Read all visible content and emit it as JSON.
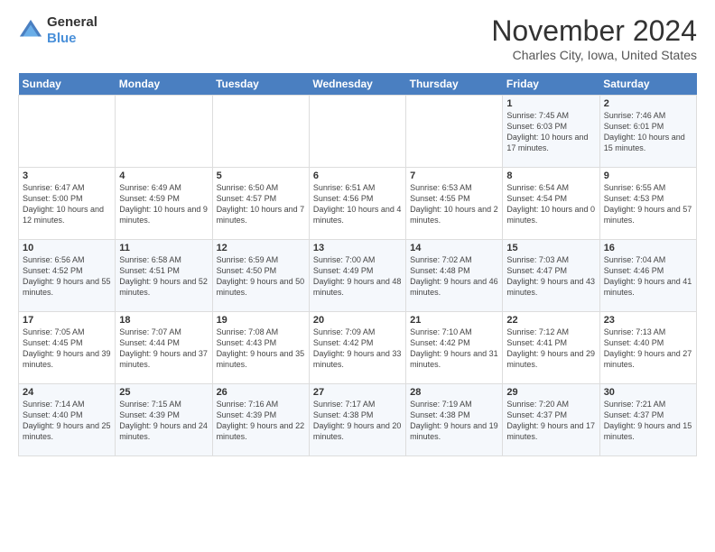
{
  "logo": {
    "line1": "General",
    "line2": "Blue"
  },
  "title": "November 2024",
  "subtitle": "Charles City, Iowa, United States",
  "days_of_week": [
    "Sunday",
    "Monday",
    "Tuesday",
    "Wednesday",
    "Thursday",
    "Friday",
    "Saturday"
  ],
  "weeks": [
    [
      {
        "day": "",
        "info": ""
      },
      {
        "day": "",
        "info": ""
      },
      {
        "day": "",
        "info": ""
      },
      {
        "day": "",
        "info": ""
      },
      {
        "day": "",
        "info": ""
      },
      {
        "day": "1",
        "info": "Sunrise: 7:45 AM\nSunset: 6:03 PM\nDaylight: 10 hours and 17 minutes."
      },
      {
        "day": "2",
        "info": "Sunrise: 7:46 AM\nSunset: 6:01 PM\nDaylight: 10 hours and 15 minutes."
      }
    ],
    [
      {
        "day": "3",
        "info": "Sunrise: 6:47 AM\nSunset: 5:00 PM\nDaylight: 10 hours and 12 minutes."
      },
      {
        "day": "4",
        "info": "Sunrise: 6:49 AM\nSunset: 4:59 PM\nDaylight: 10 hours and 9 minutes."
      },
      {
        "day": "5",
        "info": "Sunrise: 6:50 AM\nSunset: 4:57 PM\nDaylight: 10 hours and 7 minutes."
      },
      {
        "day": "6",
        "info": "Sunrise: 6:51 AM\nSunset: 4:56 PM\nDaylight: 10 hours and 4 minutes."
      },
      {
        "day": "7",
        "info": "Sunrise: 6:53 AM\nSunset: 4:55 PM\nDaylight: 10 hours and 2 minutes."
      },
      {
        "day": "8",
        "info": "Sunrise: 6:54 AM\nSunset: 4:54 PM\nDaylight: 10 hours and 0 minutes."
      },
      {
        "day": "9",
        "info": "Sunrise: 6:55 AM\nSunset: 4:53 PM\nDaylight: 9 hours and 57 minutes."
      }
    ],
    [
      {
        "day": "10",
        "info": "Sunrise: 6:56 AM\nSunset: 4:52 PM\nDaylight: 9 hours and 55 minutes."
      },
      {
        "day": "11",
        "info": "Sunrise: 6:58 AM\nSunset: 4:51 PM\nDaylight: 9 hours and 52 minutes."
      },
      {
        "day": "12",
        "info": "Sunrise: 6:59 AM\nSunset: 4:50 PM\nDaylight: 9 hours and 50 minutes."
      },
      {
        "day": "13",
        "info": "Sunrise: 7:00 AM\nSunset: 4:49 PM\nDaylight: 9 hours and 48 minutes."
      },
      {
        "day": "14",
        "info": "Sunrise: 7:02 AM\nSunset: 4:48 PM\nDaylight: 9 hours and 46 minutes."
      },
      {
        "day": "15",
        "info": "Sunrise: 7:03 AM\nSunset: 4:47 PM\nDaylight: 9 hours and 43 minutes."
      },
      {
        "day": "16",
        "info": "Sunrise: 7:04 AM\nSunset: 4:46 PM\nDaylight: 9 hours and 41 minutes."
      }
    ],
    [
      {
        "day": "17",
        "info": "Sunrise: 7:05 AM\nSunset: 4:45 PM\nDaylight: 9 hours and 39 minutes."
      },
      {
        "day": "18",
        "info": "Sunrise: 7:07 AM\nSunset: 4:44 PM\nDaylight: 9 hours and 37 minutes."
      },
      {
        "day": "19",
        "info": "Sunrise: 7:08 AM\nSunset: 4:43 PM\nDaylight: 9 hours and 35 minutes."
      },
      {
        "day": "20",
        "info": "Sunrise: 7:09 AM\nSunset: 4:42 PM\nDaylight: 9 hours and 33 minutes."
      },
      {
        "day": "21",
        "info": "Sunrise: 7:10 AM\nSunset: 4:42 PM\nDaylight: 9 hours and 31 minutes."
      },
      {
        "day": "22",
        "info": "Sunrise: 7:12 AM\nSunset: 4:41 PM\nDaylight: 9 hours and 29 minutes."
      },
      {
        "day": "23",
        "info": "Sunrise: 7:13 AM\nSunset: 4:40 PM\nDaylight: 9 hours and 27 minutes."
      }
    ],
    [
      {
        "day": "24",
        "info": "Sunrise: 7:14 AM\nSunset: 4:40 PM\nDaylight: 9 hours and 25 minutes."
      },
      {
        "day": "25",
        "info": "Sunrise: 7:15 AM\nSunset: 4:39 PM\nDaylight: 9 hours and 24 minutes."
      },
      {
        "day": "26",
        "info": "Sunrise: 7:16 AM\nSunset: 4:39 PM\nDaylight: 9 hours and 22 minutes."
      },
      {
        "day": "27",
        "info": "Sunrise: 7:17 AM\nSunset: 4:38 PM\nDaylight: 9 hours and 20 minutes."
      },
      {
        "day": "28",
        "info": "Sunrise: 7:19 AM\nSunset: 4:38 PM\nDaylight: 9 hours and 19 minutes."
      },
      {
        "day": "29",
        "info": "Sunrise: 7:20 AM\nSunset: 4:37 PM\nDaylight: 9 hours and 17 minutes."
      },
      {
        "day": "30",
        "info": "Sunrise: 7:21 AM\nSunset: 4:37 PM\nDaylight: 9 hours and 15 minutes."
      }
    ]
  ]
}
